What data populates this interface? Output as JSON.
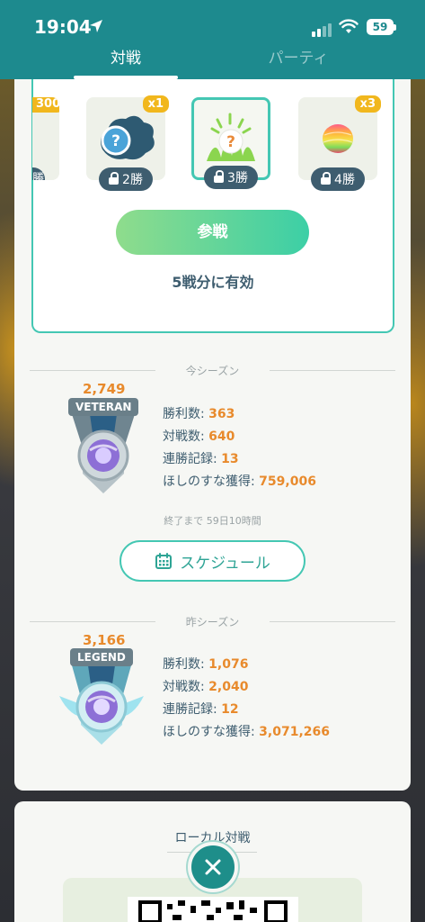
{
  "status_bar": {
    "time": "19:04",
    "battery": "59"
  },
  "tabs": [
    {
      "label": "対戦",
      "active": true
    },
    {
      "label": "パーティ",
      "active": false
    }
  ],
  "rewards": {
    "partial": {
      "badge": "300",
      "lock_label": "勝"
    },
    "items": [
      {
        "icon": "mystery-egg-icon",
        "badge": "x1",
        "lock_label": "2勝",
        "selected": false
      },
      {
        "icon": "mystery-grass-encounter-icon",
        "badge": "",
        "lock_label": "3勝",
        "selected": true
      },
      {
        "icon": "rainbow-berry-icon",
        "badge": "x3",
        "lock_label": "4勝",
        "selected": false
      }
    ],
    "join_label": "参戦",
    "valid_text": "5戦分に有効"
  },
  "current_season": {
    "header": "今シーズン",
    "rating": "2,749",
    "rank": "VETERAN",
    "stats": [
      {
        "label": "勝利数: ",
        "value": "363"
      },
      {
        "label": "対戦数: ",
        "value": "640"
      },
      {
        "label": "連勝記録: ",
        "value": "13"
      },
      {
        "label": "ほしのすな獲得: ",
        "value": "759,006"
      }
    ],
    "ends_text": "終了まで 59日10時間",
    "schedule_label": "スケジュール"
  },
  "previous_season": {
    "header": "昨シーズン",
    "rating": "3,166",
    "rank": "LEGEND",
    "stats": [
      {
        "label": "勝利数: ",
        "value": "1,076"
      },
      {
        "label": "対戦数: ",
        "value": "2,040"
      },
      {
        "label": "連勝記録: ",
        "value": "12"
      },
      {
        "label": "ほしのすな獲得: ",
        "value": "3,071,266"
      }
    ]
  },
  "local_battle": {
    "title": "ローカル対戦"
  },
  "colors": {
    "header": "#1d8a8e",
    "accent": "#44c7b3",
    "orange": "#e88a2c",
    "navy": "#3e5d6f"
  }
}
